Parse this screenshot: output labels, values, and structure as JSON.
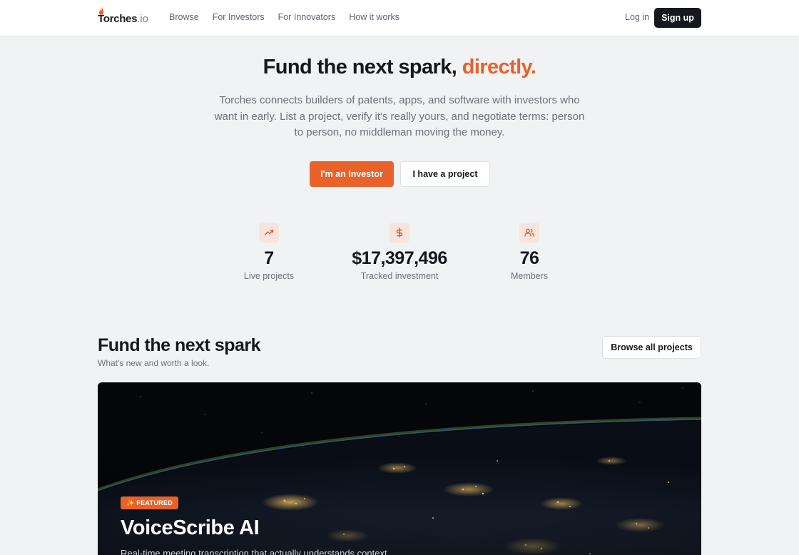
{
  "nav": {
    "logo_text": "Torches",
    "logo_tld": ".io",
    "links": [
      "Browse",
      "For Investors",
      "For Innovators",
      "How it works"
    ],
    "login": "Log in",
    "signup": "Sign up"
  },
  "hero": {
    "title": "Fund the next spark,",
    "title_accent": "directly.",
    "subtitle": "Torches connects builders of patents, apps, and software with investors who want in early. List a project, verify it's really yours, and negotiate terms: person to person, no middleman moving the money.",
    "primary_cta": "I'm an Investor",
    "secondary_cta": "I have a project"
  },
  "stats": [
    {
      "icon": "trending-up-icon",
      "value": "7",
      "label": "Live projects"
    },
    {
      "icon": "dollar-icon",
      "value": "$17,397,496",
      "label": "Tracked investment"
    },
    {
      "icon": "users-icon",
      "value": "76",
      "label": "Members"
    }
  ],
  "section": {
    "title": "Fund the next spark",
    "subtitle": "What's new and worth a look.",
    "browse_all": "Browse all projects"
  },
  "featured": {
    "badge": "✨ FEATURED",
    "title": "VoiceScribe AI",
    "tagline": "Real-time meeting transcription that actually understands context."
  },
  "colors": {
    "accent": "#e8622a",
    "dark": "#16181d",
    "background": "#f1f2f4"
  }
}
